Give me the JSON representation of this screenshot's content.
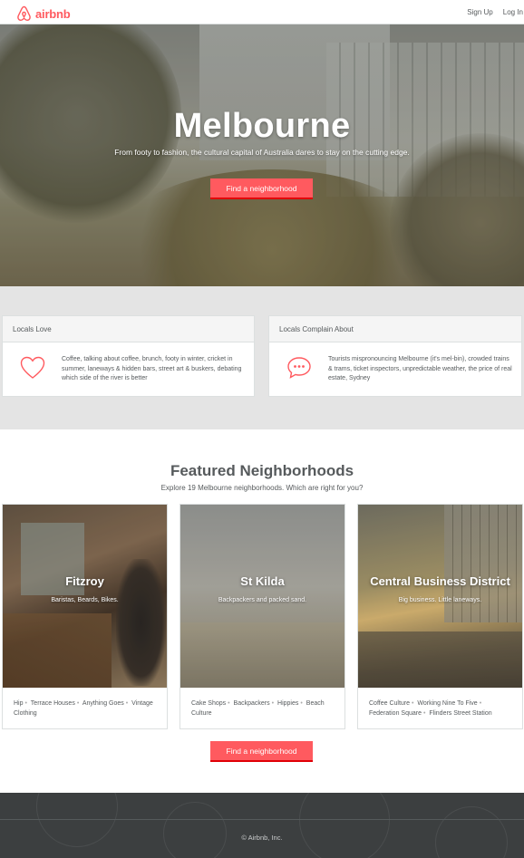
{
  "header": {
    "logo_text": "airbnb",
    "nav": {
      "sign_up": "Sign Up",
      "log_in": "Log In"
    }
  },
  "hero": {
    "title": "Melbourne",
    "subtitle": "From footy to fashion, the cultural capital of Australia dares to stay on the cutting edge.",
    "button": "Find a neighborhood"
  },
  "locals": {
    "love": {
      "heading": "Locals Love",
      "icon": "heart-icon",
      "text": "Coffee, talking about coffee, brunch, footy in winter, cricket in summer, laneways & hidden bars, street art & buskers, debating which side of the river is better"
    },
    "complain": {
      "heading": "Locals Complain About",
      "icon": "speech-bubble-icon",
      "text": "Tourists mispronouncing Melbourne (it's mel-bin), crowded trains & trams, ticket inspectors, unpredictable weather, the price of real estate, Sydney"
    }
  },
  "featured": {
    "title": "Featured Neighborhoods",
    "subtitle": "Explore 19 Melbourne neighborhoods. Which are right for you?",
    "button": "Find a neighborhood",
    "neighborhoods": [
      {
        "name": "Fitzroy",
        "tagline": "Baristas, Beards, Bikes.",
        "tags": [
          "Hip",
          "Terrace Houses",
          "Anything Goes",
          "Vintage Clothing"
        ]
      },
      {
        "name": "St Kilda",
        "tagline": "Backpackers and packed sand.",
        "tags": [
          "Cake Shops",
          "Backpackers",
          "Hippies",
          "Beach Culture"
        ]
      },
      {
        "name": "Central Business District",
        "tagline": "Big business. Little laneways.",
        "tags": [
          "Coffee Culture",
          "Working Nine To Five",
          "Federation Square",
          "Flinders Street Station"
        ]
      }
    ]
  },
  "footer": {
    "copyright": "© Airbnb, Inc."
  },
  "colors": {
    "brand": "#ff5a5f",
    "text": "#565a5c",
    "footer_bg": "#3c3f40"
  }
}
